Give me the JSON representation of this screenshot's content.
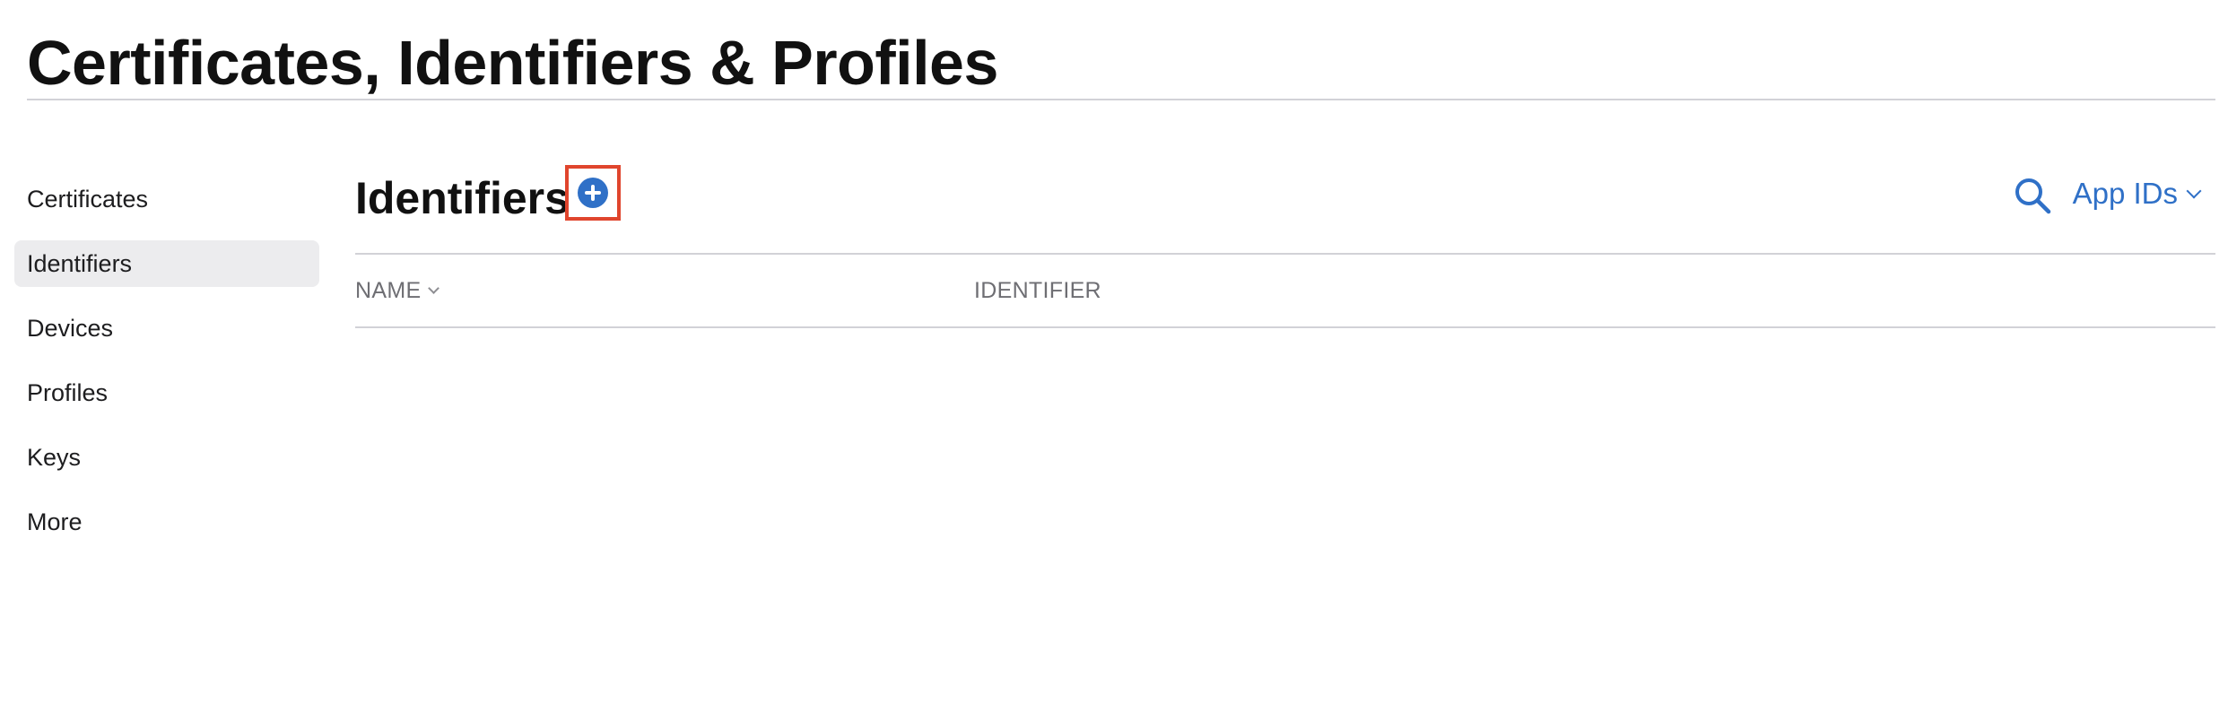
{
  "page": {
    "title": "Certificates, Identifiers & Profiles"
  },
  "sidebar": {
    "items": [
      {
        "label": "Certificates",
        "active": false
      },
      {
        "label": "Identifiers",
        "active": true
      },
      {
        "label": "Devices",
        "active": false
      },
      {
        "label": "Profiles",
        "active": false
      },
      {
        "label": "Keys",
        "active": false
      },
      {
        "label": "More",
        "active": false
      }
    ]
  },
  "main": {
    "section_title": "Identifiers",
    "add_icon": "plus-circle-icon",
    "search_icon": "search-icon",
    "filter": {
      "selected": "App IDs"
    },
    "table": {
      "columns": [
        {
          "label": "NAME",
          "sortable": true
        },
        {
          "label": "IDENTIFIER",
          "sortable": false
        }
      ],
      "rows": []
    }
  },
  "colors": {
    "accent": "#2f70c7",
    "highlight_border": "#e0452d",
    "active_item_bg": "#ececee",
    "divider": "#d2d2d7",
    "muted_text": "#6e6e73"
  }
}
